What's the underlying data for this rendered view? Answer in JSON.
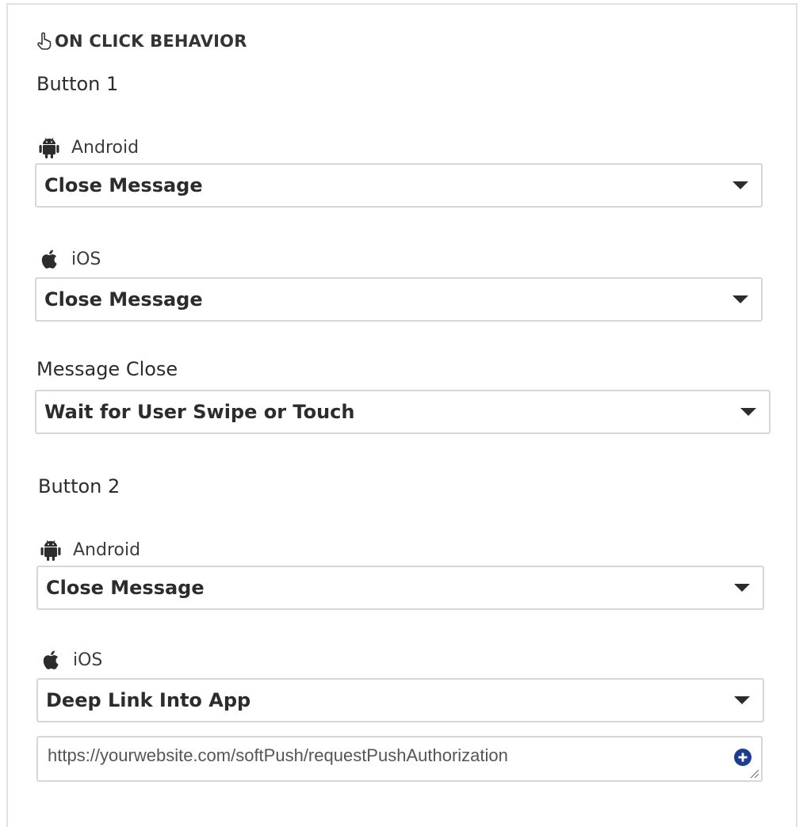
{
  "section": {
    "title": "ON CLICK BEHAVIOR",
    "icon": "hand-pointer-icon"
  },
  "button1": {
    "label": "Button 1",
    "android": {
      "label": "Android",
      "icon": "android-icon",
      "value": "Close Message"
    },
    "ios": {
      "label": "iOS",
      "icon": "apple-icon",
      "value": "Close Message"
    }
  },
  "message_close": {
    "label": "Message Close",
    "value": "Wait for User Swipe or Touch"
  },
  "button2": {
    "label": "Button 2",
    "android": {
      "label": "Android",
      "icon": "android-icon",
      "value": "Close Message"
    },
    "ios": {
      "label": "iOS",
      "icon": "apple-icon",
      "value": "Deep Link Into App"
    },
    "deep_link": {
      "value": "https://yourwebsite.com/softPush/requestPushAuthorization",
      "add_icon": "plus-circle-icon"
    }
  }
}
